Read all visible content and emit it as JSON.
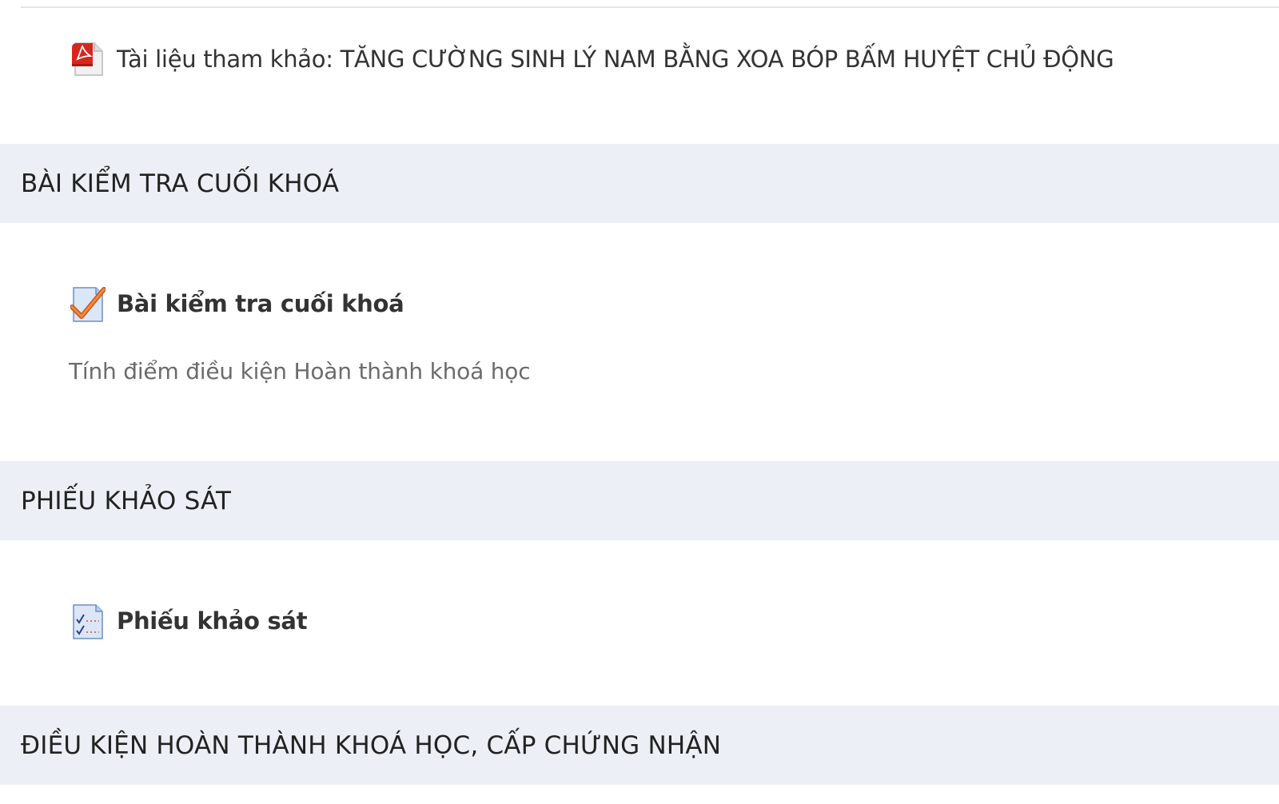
{
  "resource": {
    "label": "Tài liệu tham khảo: TĂNG CƯỜNG SINH LÝ NAM BẰNG XOA BÓP BẤM HUYỆT CHỦ ĐỘNG",
    "icon": "pdf-icon"
  },
  "sections": [
    {
      "title": "BÀI KIỂM TRA CUỐI KHOÁ",
      "activity": {
        "label": "Bài kiểm tra cuối khoá",
        "icon": "quiz-icon",
        "description": "Tính điểm điều kiện Hoàn thành khoá học"
      }
    },
    {
      "title": "PHIẾU KHẢO SÁT",
      "activity": {
        "label": "Phiếu khảo sát",
        "icon": "feedback-icon"
      }
    },
    {
      "title": "ĐIỀU KIỆN HOÀN THÀNH KHOÁ HỌC, CẤP CHỨNG NHẬN"
    }
  ],
  "colors": {
    "section_header_bg": "#eceff5",
    "text": "#333333",
    "description_text": "#6b6b6b",
    "pdf_red": "#d7261e",
    "check_orange": "#e8702a"
  }
}
